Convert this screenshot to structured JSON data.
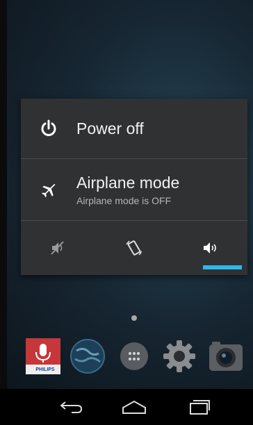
{
  "power_menu": {
    "power_off_label": "Power off",
    "airplane_label": "Airplane mode",
    "airplane_status": "Airplane mode is OFF"
  },
  "sound_modes": {
    "items": [
      "silent",
      "vibrate",
      "sound-on"
    ],
    "active": "sound-on"
  },
  "dock": {
    "brand_label": "PHILIPS"
  },
  "colors": {
    "accent": "#33b5e5",
    "dialog_bg": "#2f3133"
  }
}
